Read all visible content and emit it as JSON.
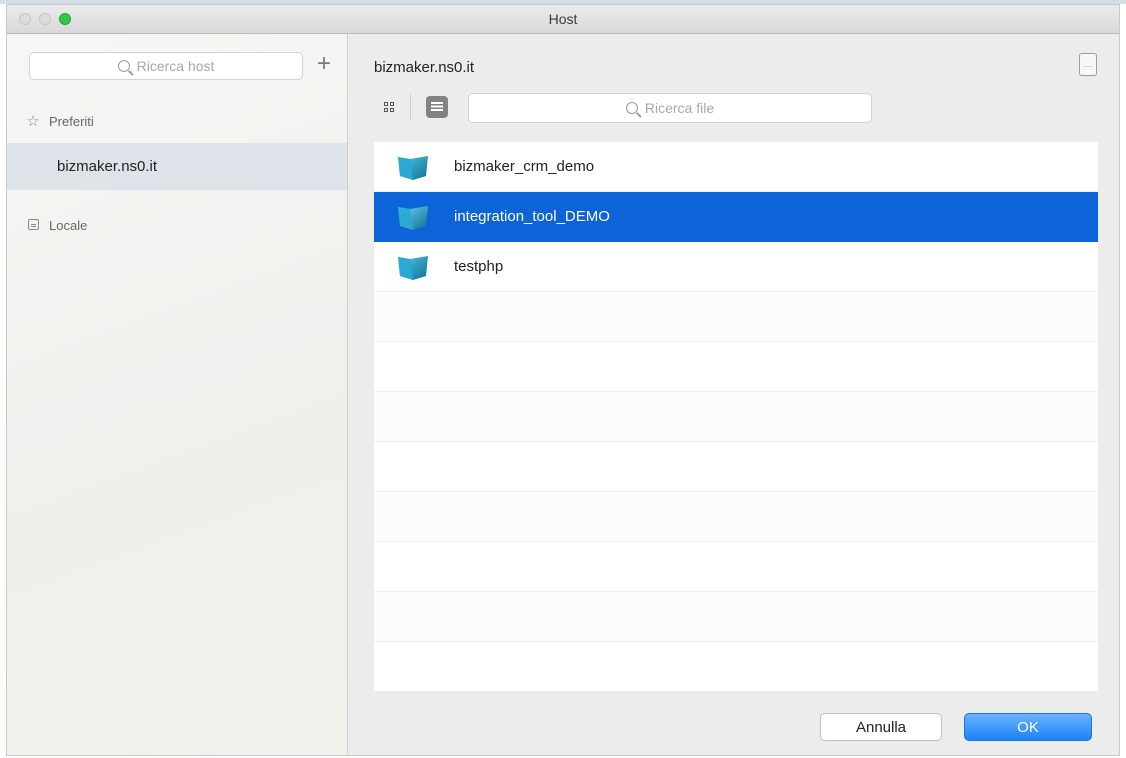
{
  "window": {
    "title": "Host"
  },
  "sidebar": {
    "search_placeholder": "Ricerca host",
    "add_symbol": "+",
    "favorites_label": "Preferiti",
    "favorites_icon": "star-icon",
    "hosts": [
      {
        "label": "bizmaker.ns0.it",
        "selected": true
      }
    ],
    "local_label": "Locale",
    "local_icon": "local-drive-icon"
  },
  "main": {
    "path": "bizmaker.ns0.it",
    "file_search_placeholder": "Ricerca file",
    "view_mode": "list",
    "files": [
      {
        "name": "bizmaker_crm_demo",
        "icon": "filemaker-folder-icon",
        "selected": false
      },
      {
        "name": "integration_tool_DEMO",
        "icon": "filemaker-folder-icon",
        "selected": true
      },
      {
        "name": "testphp",
        "icon": "filemaker-folder-icon",
        "selected": false
      }
    ]
  },
  "buttons": {
    "cancel": "Annulla",
    "ok": "OK"
  },
  "colors": {
    "selection": "#0d63d8",
    "ok_button": "#1a82fb",
    "traffic_green": "#35c649"
  }
}
